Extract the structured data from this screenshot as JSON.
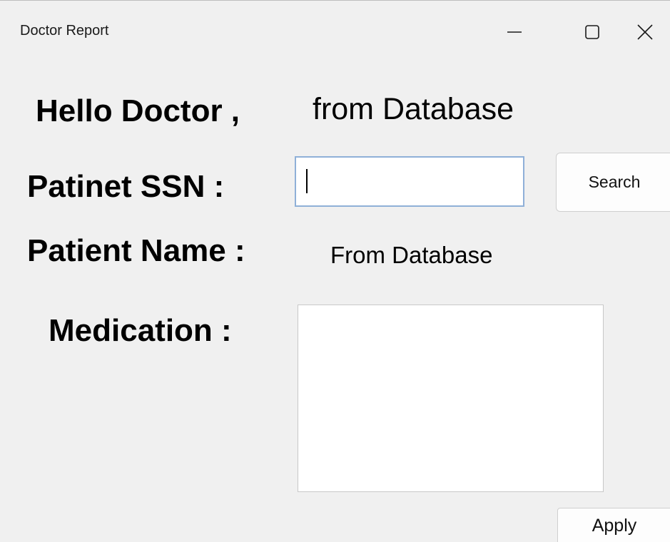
{
  "window": {
    "title": "Doctor Report",
    "controls": {
      "minimize_icon": "minimize-icon",
      "maximize_icon": "maximize-icon",
      "close_icon": "close-icon"
    }
  },
  "greeting": {
    "label": "Hello Doctor ,",
    "value": "from Database"
  },
  "ssn": {
    "label": "Patinet SSN :",
    "value": "",
    "search_label": "Search"
  },
  "patient_name": {
    "label": "Patient Name :",
    "value": "From Database"
  },
  "medication": {
    "label": "Medication :",
    "value": ""
  },
  "actions": {
    "apply_label": "Apply"
  },
  "colors": {
    "background": "#f0f0f0",
    "input_focus_border": "#8fb0d8"
  }
}
